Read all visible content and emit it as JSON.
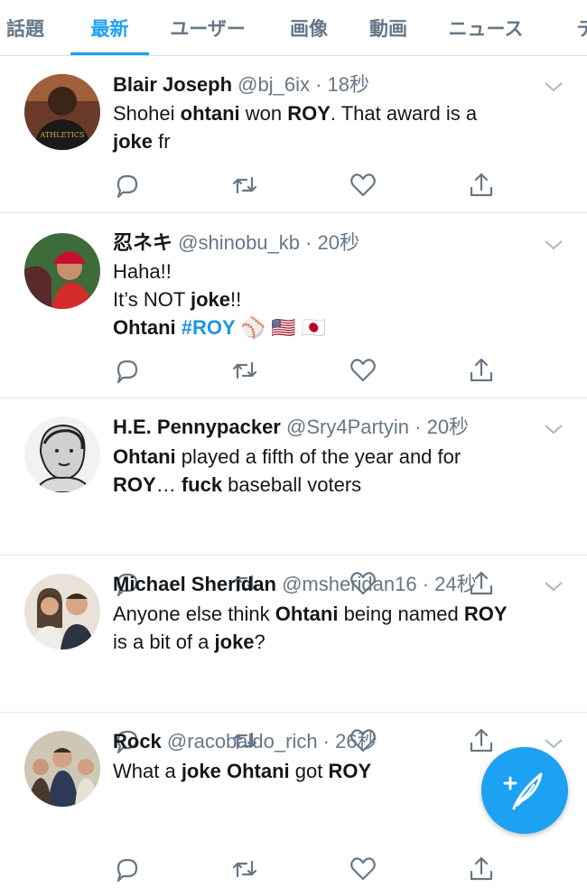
{
  "tabs": [
    {
      "label": "話題",
      "active": false
    },
    {
      "label": "最新",
      "active": true
    },
    {
      "label": "ユーザー",
      "active": false
    },
    {
      "label": "画像",
      "active": false
    },
    {
      "label": "動画",
      "active": false
    },
    {
      "label": "ニュース",
      "active": false
    },
    {
      "label": "テ",
      "active": false
    }
  ],
  "accent_color": "#1da1f2",
  "tweets": [
    {
      "name": "Blair Joseph",
      "meta": "@bj_6ix · 18秒",
      "text": [
        [
          {
            "t": "Shohei "
          },
          {
            "t": "ohtani",
            "b": true
          },
          {
            "t": " won "
          },
          {
            "t": "ROY",
            "b": true
          },
          {
            "t": ". That award is a"
          }
        ],
        [
          {
            "t": "joke",
            "b": true
          },
          {
            "t": " fr"
          }
        ]
      ]
    },
    {
      "name": "忍ネキ",
      "meta": "@shinobu_kb · 20秒",
      "text": [
        [
          {
            "t": "Haha!!"
          }
        ],
        [
          {
            "t": "It’s NOT "
          },
          {
            "t": "joke",
            "b": true
          },
          {
            "t": "!!"
          }
        ],
        [
          {
            "t": "Ohtani",
            "b": true
          },
          {
            "t": " "
          },
          {
            "t": "#ROY",
            "h": true
          },
          {
            "t": " ⚾ 🇺🇸 🇯🇵"
          }
        ]
      ]
    },
    {
      "name": "H.E. Pennypacker",
      "meta": "@Sry4Partyin · 20秒",
      "text": [
        [
          {
            "t": "Ohtani",
            "b": true
          },
          {
            "t": " played a fifth of the year and for"
          }
        ],
        [
          {
            "t": "ROY",
            "b": true
          },
          {
            "t": "… "
          },
          {
            "t": "fuck",
            "b": true
          },
          {
            "t": " baseball voters"
          }
        ]
      ]
    },
    {
      "name": "Michael Sheridan",
      "meta": "@msheridan16 · 24秒",
      "text": [
        [
          {
            "t": "Anyone else think "
          },
          {
            "t": "Ohtani",
            "b": true
          },
          {
            "t": " being named "
          },
          {
            "t": "ROY",
            "b": true
          }
        ],
        [
          {
            "t": "is a bit of a "
          },
          {
            "t": "joke",
            "b": true
          },
          {
            "t": "?"
          }
        ]
      ]
    },
    {
      "name": "Rock",
      "meta": "@racobaldo_rich · 26秒",
      "text": [
        [
          {
            "t": "What a "
          },
          {
            "t": "joke",
            "b": true
          },
          {
            "t": " "
          },
          {
            "t": "Ohtani",
            "b": true
          },
          {
            "t": " got "
          },
          {
            "t": "ROY",
            "b": true
          }
        ]
      ]
    }
  ],
  "icons": {
    "reply": "reply-icon",
    "retweet": "retweet-icon",
    "like": "heart-icon",
    "share": "share-icon",
    "compose": "compose-tweet-icon"
  }
}
